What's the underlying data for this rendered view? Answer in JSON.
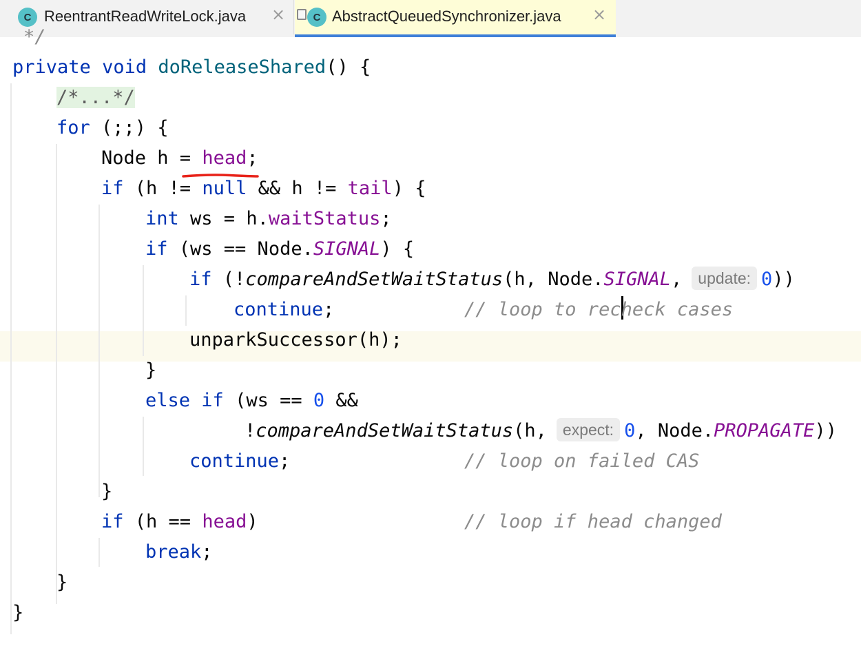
{
  "tabs": [
    {
      "label": "ReentrantReadWriteLock.java",
      "icon": "C",
      "active": false
    },
    {
      "label": "AbstractQueuedSynchronizer.java",
      "icon": "C",
      "active": true
    }
  ],
  "editor": {
    "l00": "*/",
    "l01": {
      "private": "private",
      "void": "void",
      "name": "doReleaseShared",
      "rest": "() {"
    },
    "l02": "/*...*/",
    "l03": {
      "for": "for",
      "rest": " (;;) {"
    },
    "l04": {
      "a": "Node h = ",
      "head": "head",
      "b": ";"
    },
    "l05": {
      "if": "if",
      "a": " (h != ",
      "null": "null",
      "b": " && h != ",
      "tail": "tail",
      "c": ") {"
    },
    "l06": {
      "int": "int",
      "a": " ws = h.",
      "field": "waitStatus",
      "b": ";"
    },
    "l07": {
      "if": "if",
      "a": " (ws == Node.",
      "signal": "SIGNAL",
      "b": ") {"
    },
    "l08": {
      "if": "if",
      "a": " (!",
      "method": "compareAndSetWaitStatus",
      "b": "(h, Node.",
      "signal": "SIGNAL",
      "c": ",",
      "hint": "update:",
      "zero": "0",
      "d": "))"
    },
    "l09": {
      "continue": "continue",
      "a": ";",
      "comment_a": "// loop to rec",
      "comment_b": "heck cases"
    },
    "l10": "unparkSuccessor(h);",
    "l11": "}",
    "l12": {
      "else": "else",
      "if": "if",
      "a": " (ws == ",
      "zero": "0",
      "b": " &&"
    },
    "l13": {
      "a": "!",
      "method": "compareAndSetWaitStatus",
      "b": "(h,",
      "hint": "expect:",
      "zero": "0",
      "c": ", Node.",
      "propagate": "PROPAGATE",
      "d": "))"
    },
    "l14": {
      "continue": "continue",
      "a": ";",
      "comment": "// loop on failed CAS"
    },
    "l15": "}",
    "l16": {
      "if": "if",
      "a": " (h == ",
      "head": "head",
      "b": ")",
      "comment": "// loop if head changed"
    },
    "l17": {
      "break": "break",
      "a": ";"
    },
    "l18": "}",
    "l19": "}"
  },
  "colors": {
    "keyword": "#0033b3",
    "method_decl": "#00627a",
    "field": "#871094",
    "number": "#1750eb",
    "comment": "#8c8c8c",
    "tab_active_bg": "#fefdd7",
    "tab_underline": "#3d7fd8",
    "annotation_red": "#e8231a"
  }
}
